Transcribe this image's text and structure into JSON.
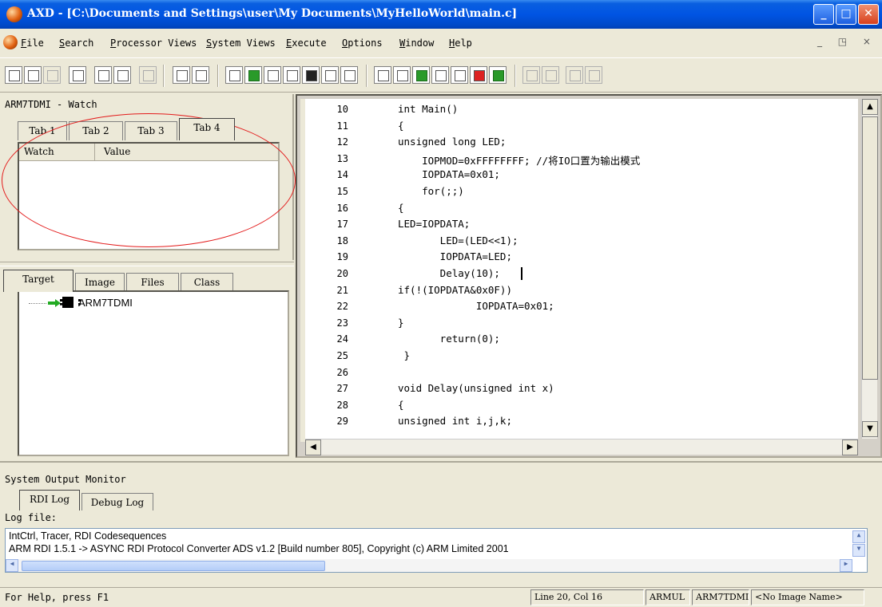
{
  "window": {
    "title": "AXD - [C:\\Documents and Settings\\user\\My Documents\\MyHelloWorld\\main.c]",
    "controls": {
      "minimize": "_",
      "maximize": "□",
      "close": "✕"
    }
  },
  "menu": {
    "items": [
      "File",
      "Search",
      "Processor Views",
      "System Views",
      "Execute",
      "Options",
      "Window",
      "Help"
    ],
    "mdi_controls": "_ ◳ ×"
  },
  "watch_panel": {
    "title": "ARM7TDMI - Watch",
    "tabs": [
      "Tab 1",
      "Tab 2",
      "Tab 3",
      "Tab 4"
    ],
    "active_tab": "Tab 4",
    "columns": [
      "Watch",
      "Value"
    ]
  },
  "target_panel": {
    "tabs": [
      "Target",
      "Image",
      "Files",
      "Class"
    ],
    "tree_items": [
      "ARM7TDMI"
    ]
  },
  "editor": {
    "lines": [
      {
        "num": "10",
        "code": "int Main()"
      },
      {
        "num": "11",
        "code": "{"
      },
      {
        "num": "12",
        "code": "unsigned long LED;"
      },
      {
        "num": "13",
        "code": "    IOPMOD=0xFFFFFFFF; //将IO口置为输出模式"
      },
      {
        "num": "14",
        "code": "    IOPDATA=0x01;"
      },
      {
        "num": "15",
        "code": "    for(;;)"
      },
      {
        "num": "16",
        "code": "{"
      },
      {
        "num": "17",
        "code": "LED=IOPDATA;"
      },
      {
        "num": "18",
        "code": "       LED=(LED<<1);"
      },
      {
        "num": "19",
        "code": "       IOPDATA=LED;"
      },
      {
        "num": "20",
        "code": "       Delay(10);"
      },
      {
        "num": "21",
        "code": "if(!(IOPDATA&0x0F))"
      },
      {
        "num": "22",
        "code": "             IOPDATA=0x01;"
      },
      {
        "num": "23",
        "code": "}"
      },
      {
        "num": "24",
        "code": "       return(0);"
      },
      {
        "num": "25",
        "code": " }"
      },
      {
        "num": "26",
        "code": ""
      },
      {
        "num": "27",
        "code": "void Delay(unsigned int x)"
      },
      {
        "num": "28",
        "code": "{"
      },
      {
        "num": "29",
        "code": "unsigned int i,j,k;"
      }
    ]
  },
  "system_output": {
    "title": "System Output Monitor",
    "tabs": [
      "RDI Log",
      "Debug Log"
    ],
    "log_label": "Log file:",
    "log_lines": [
      "IntCtrl, Tracer, RDI Codesequences",
      "ARM RDI 1.5.1 -> ASYNC RDI Protocol Converter ADS v1.2 [Build number 805], Copyright (c) ARM Limited 2001"
    ]
  },
  "status": {
    "help": "For Help, press F1",
    "position": "Line 20, Col 16",
    "target": "ARMUL",
    "processor": "ARM7TDMI",
    "image": "<No Image Name>"
  },
  "colors": {
    "annotation": "#e31b1b",
    "titlebar": "#0054e3"
  }
}
